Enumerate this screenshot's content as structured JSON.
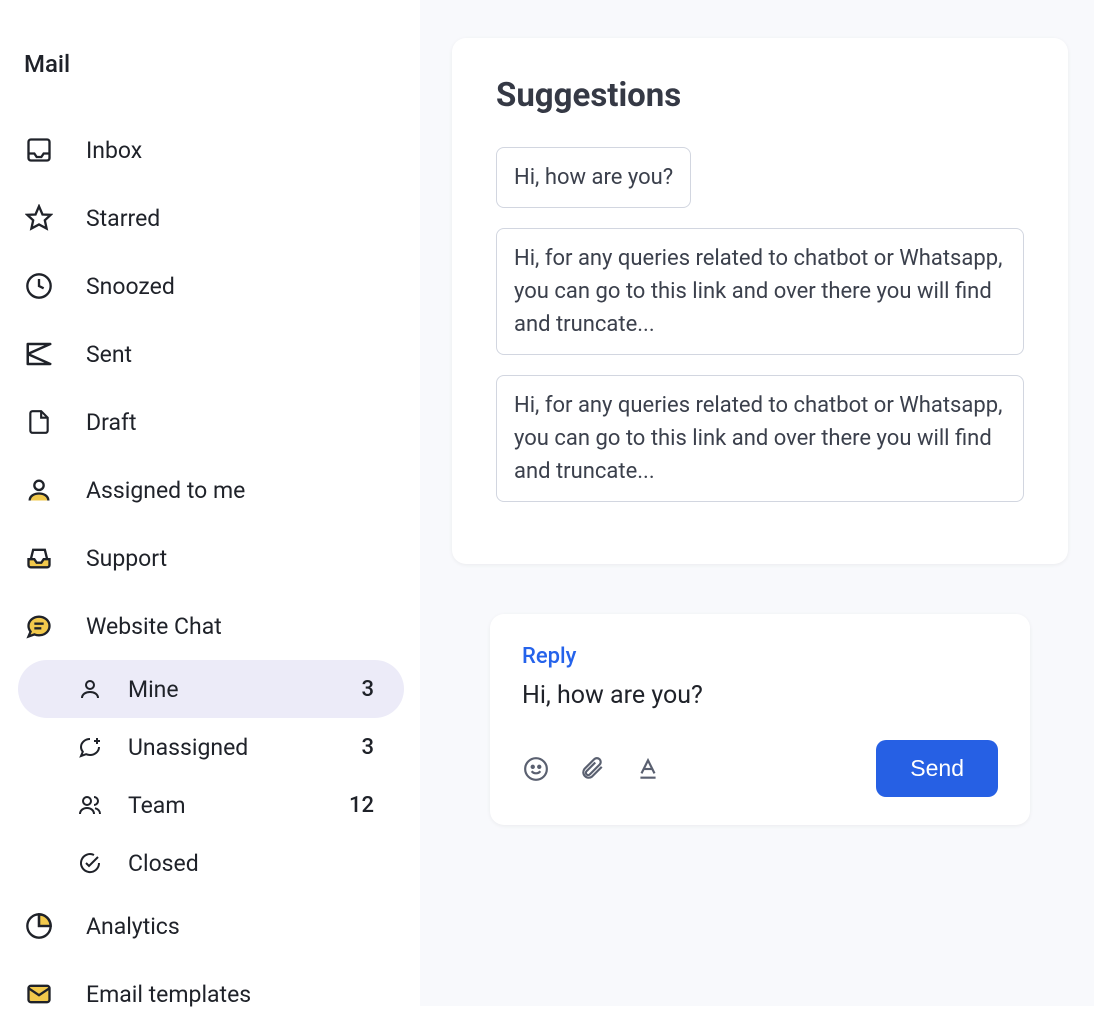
{
  "sidebar": {
    "title": "Mail",
    "items": [
      {
        "label": "Inbox",
        "icon": "inbox"
      },
      {
        "label": "Starred",
        "icon": "star"
      },
      {
        "label": "Snoozed",
        "icon": "clock"
      },
      {
        "label": "Sent",
        "icon": "send"
      },
      {
        "label": "Draft",
        "icon": "file"
      },
      {
        "label": "Assigned to me",
        "icon": "person"
      },
      {
        "label": "Support",
        "icon": "tray"
      },
      {
        "label": "Website Chat",
        "icon": "chatbubble"
      }
    ],
    "subitems": [
      {
        "label": "Mine",
        "icon": "person",
        "count": "3",
        "active": true
      },
      {
        "label": "Unassigned",
        "icon": "chat-plus",
        "count": "3",
        "active": false
      },
      {
        "label": "Team",
        "icon": "people",
        "count": "12",
        "active": false
      },
      {
        "label": "Closed",
        "icon": "check-circle",
        "count": "",
        "active": false
      }
    ],
    "bottom": [
      {
        "label": "Analytics",
        "icon": "piechart"
      },
      {
        "label": "Email templates",
        "icon": "envelope"
      }
    ]
  },
  "suggestions": {
    "title": "Suggestions",
    "items": [
      "Hi, how are you?",
      "Hi, for any queries related to chatbot or Whatsapp, you can go to this link and over there you will find and truncate...",
      "Hi, for any queries related to chatbot or Whatsapp, you can go to this link and over there you will find and truncate..."
    ]
  },
  "reply": {
    "label": "Reply",
    "text": "Hi, how are you?",
    "send_label": "Send"
  },
  "colors": {
    "accent": "#2660E4",
    "active_bg": "#ECEBF8",
    "main_bg": "#F8F9FC",
    "yellow": "#F2C94C"
  }
}
